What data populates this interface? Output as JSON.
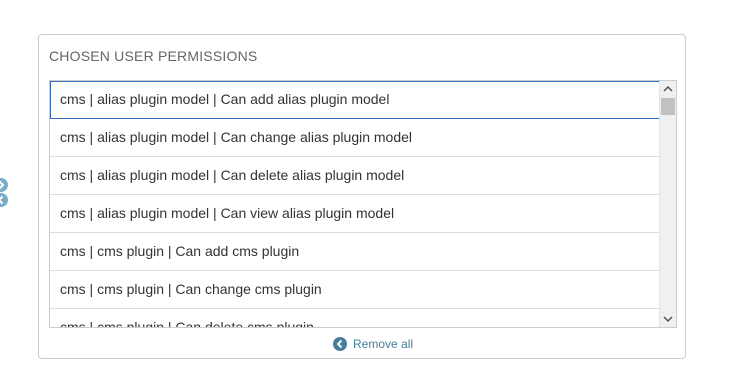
{
  "chosen": {
    "title": "CHOSEN USER PERMISSIONS",
    "items": [
      {
        "label": "cms | alias plugin model | Can add alias plugin model"
      },
      {
        "label": "cms | alias plugin model | Can change alias plugin model"
      },
      {
        "label": "cms | alias plugin model | Can delete alias plugin model"
      },
      {
        "label": "cms | alias plugin model | Can view alias plugin model"
      },
      {
        "label": "cms | cms plugin | Can add cms plugin"
      },
      {
        "label": "cms | cms plugin | Can change cms plugin"
      },
      {
        "label": "cms | cms plugin | Can delete cms plugin"
      }
    ],
    "remove_all_label": "Remove all"
  },
  "icons": {
    "move_right": "chevron-right-icon",
    "move_left": "chevron-left-icon",
    "remove_all": "chevron-left-circle-icon"
  },
  "colors": {
    "accent": "#447e9b",
    "move_icon": "#79aec8",
    "focus_border": "#2f6fb8"
  }
}
